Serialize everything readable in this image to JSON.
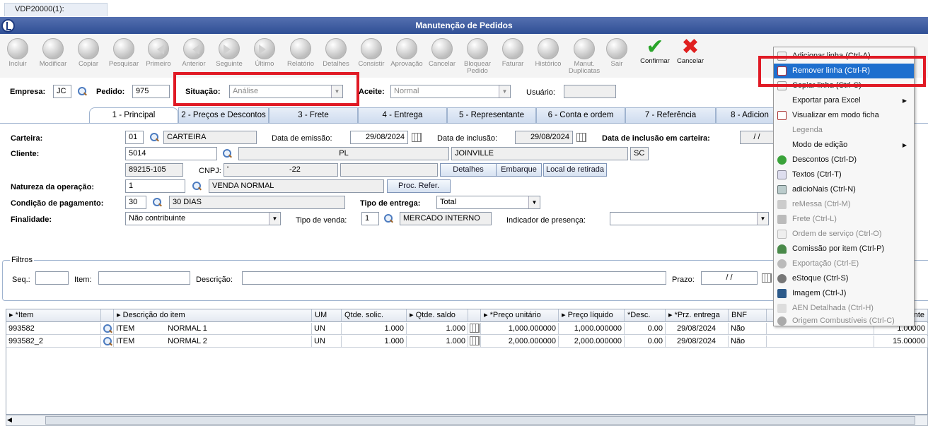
{
  "doc_tab": "VDP20000(1):",
  "window_title": "Manutenção de Pedidos",
  "toolbar": [
    {
      "id": "incluir",
      "label": "Incluir",
      "icon": "add-doc-icon"
    },
    {
      "id": "modificar",
      "label": "Modificar",
      "icon": "edit-icon"
    },
    {
      "id": "copiar",
      "label": "Copiar",
      "icon": "copy-icon"
    },
    {
      "id": "pesquisar",
      "label": "Pesquisar",
      "icon": "search-icon"
    },
    {
      "id": "primeiro",
      "label": "Primeiro",
      "icon": "first-icon"
    },
    {
      "id": "anterior",
      "label": "Anterior",
      "icon": "previous-icon"
    },
    {
      "id": "seguinte",
      "label": "Seguinte",
      "icon": "next-icon"
    },
    {
      "id": "ultimo",
      "label": "Último",
      "icon": "last-icon"
    },
    {
      "id": "relatorio",
      "label": "Relatório",
      "icon": "printer-icon"
    },
    {
      "id": "detalhes",
      "label": "Detalhes",
      "icon": "details-icon"
    },
    {
      "id": "consistir",
      "label": "Consistir",
      "icon": "consistir-icon"
    },
    {
      "id": "aprovacao",
      "label": "Aprovação",
      "icon": "approval-icon"
    },
    {
      "id": "cancelar1",
      "label": "Cancelar",
      "icon": "cancel-icon"
    },
    {
      "id": "bloquear",
      "label": "Bloquear\nPedido",
      "icon": "block-icon"
    },
    {
      "id": "faturar",
      "label": "Faturar",
      "icon": "invoice-icon"
    },
    {
      "id": "historico",
      "label": "Histórico",
      "icon": "history-icon"
    },
    {
      "id": "manut",
      "label": "Manut.\nDuplicatas",
      "icon": "duplicates-icon"
    },
    {
      "id": "sair",
      "label": "Sair",
      "icon": "exit-icon"
    },
    {
      "id": "confirmar",
      "label": "Confirmar",
      "icon": "check-icon"
    },
    {
      "id": "cancelar2",
      "label": "Cancelar",
      "icon": "x-icon"
    }
  ],
  "header": {
    "empresa_label": "Empresa:",
    "empresa": "JC",
    "pedido_label": "Pedido:",
    "pedido": "975",
    "situacao_label": "Situação:",
    "situacao": "Análise",
    "aceite_label": "Aceite:",
    "aceite": "Normal",
    "usuario_label": "Usuário:",
    "usuario": ""
  },
  "tabs": [
    {
      "label": "1 - Principal"
    },
    {
      "label": "2 - Preços e Descontos"
    },
    {
      "label": "3 - Frete"
    },
    {
      "label": "4 - Entrega"
    },
    {
      "label": "5 - Representante"
    },
    {
      "label": "6 - Conta e ordem"
    },
    {
      "label": "7 - Referência"
    },
    {
      "label": "8 - Adicion"
    }
  ],
  "form": {
    "carteira_label": "Carteira:",
    "carteira_code": "01",
    "carteira_desc": "CARTEIRA",
    "emissao_label": "Data de emissão:",
    "emissao": "29/08/2024",
    "inclusao_label": "Data de inclusão:",
    "inclusao": "29/08/2024",
    "inclusao_carteira_label": "Data de inclusão em carteira:",
    "inclusao_carteira": "/ /",
    "cliente_label": "Cliente:",
    "cliente_code": "5014",
    "cliente_name": "PL",
    "cidade": "JOINVILLE",
    "uf": "SC",
    "cep": "89215-105",
    "cnpj_label": "CNPJ:",
    "cnpj_prefix": "'",
    "cnpj": "-22",
    "btn_detalhes": "Detalhes",
    "btn_embarque": "Embarque",
    "btn_local": "Local de retirada",
    "natureza_label": "Natureza da operação:",
    "natureza_code": "1",
    "natureza_desc": "VENDA NORMAL",
    "btn_proc": "Proc. Refer.",
    "cond_label": "Condição de pagamento:",
    "cond_code": "30",
    "cond_desc": "30 DIAS",
    "tipo_entrega_label": "Tipo de entrega:",
    "tipo_entrega": "Total",
    "finalidade_label": "Finalidade:",
    "finalidade": "Não contribuinte",
    "tipo_venda_label": "Tipo de venda:",
    "tipo_venda_code": "1",
    "tipo_venda_desc": "MERCADO INTERNO",
    "presenca_label": "Indicador de presença:",
    "presenca": ""
  },
  "filters": {
    "legend": "Filtros",
    "seq_label": "Seq.:",
    "item_label": "Item:",
    "descricao_label": "Descrição:",
    "prazo_label": "Prazo:",
    "prazo": "/ /"
  },
  "grid": {
    "columns": [
      "*Item",
      "Descrição do item",
      "UM",
      "Qtde. solic.",
      "Qtde. saldo",
      "*Preço unitário",
      "Preço líquido",
      "*Desc.",
      "*Prz. entrega",
      "BNF",
      "",
      "nte"
    ],
    "rows": [
      {
        "item": "993582",
        "desc_a": "ITEM",
        "desc_b": "NORMAL 1",
        "um": "UN",
        "solic": "1.000",
        "saldo": "1.000",
        "preco": "1,000.000000",
        "liquido": "1,000.000000",
        "desc": "0.00",
        "prz": "29/08/2024",
        "bnf": "Não",
        "extra": "1.00000"
      },
      {
        "item": "993582_2",
        "desc_a": "ITEM",
        "desc_b": "NORMAL 2",
        "um": "UN",
        "solic": "1.000",
        "saldo": "1.000",
        "preco": "2,000.000000",
        "liquido": "2,000.000000",
        "desc": "0.00",
        "prz": "29/08/2024",
        "bnf": "Não",
        "extra": "15.00000"
      }
    ]
  },
  "context_menu": [
    {
      "label": "Adicionar linha (Ctrl-A)",
      "state": "normal",
      "icon": "add-row-icon"
    },
    {
      "label": "Remover linha (Ctrl-R)",
      "state": "highlighted",
      "icon": "remove-row-icon"
    },
    {
      "label": "Copiar linha (Ctrl-C)",
      "state": "normal",
      "icon": "copy-row-icon"
    },
    {
      "label": "Exportar para Excel",
      "state": "normal",
      "icon": "",
      "submenu": true
    },
    {
      "label": "Visualizar em modo ficha",
      "state": "normal",
      "icon": "form-view-icon"
    },
    {
      "label": "Legenda",
      "state": "disabled",
      "icon": ""
    },
    {
      "label": "Modo de edição",
      "state": "normal",
      "icon": "",
      "submenu": true
    },
    {
      "label": "Descontos (Ctrl-D)",
      "state": "normal",
      "icon": "discount-icon"
    },
    {
      "label": "Textos (Ctrl-T)",
      "state": "normal",
      "icon": "text-icon"
    },
    {
      "label": "adicioNais (Ctrl-N)",
      "state": "normal",
      "icon": "additional-icon"
    },
    {
      "label": "reMessa (Ctrl-M)",
      "state": "disabled",
      "icon": "remessa-icon"
    },
    {
      "label": "Frete (Ctrl-L)",
      "state": "disabled",
      "icon": "truck-icon"
    },
    {
      "label": "Ordem de serviço (Ctrl-O)",
      "state": "disabled",
      "icon": "service-order-icon"
    },
    {
      "label": "Comissão por item (Ctrl-P)",
      "state": "normal",
      "icon": "commission-icon"
    },
    {
      "label": "Exportação (Ctrl-E)",
      "state": "disabled",
      "icon": "export-icon"
    },
    {
      "label": "eStoque (Ctrl-S)",
      "state": "normal",
      "icon": "stock-icon"
    },
    {
      "label": "Imagem (Ctrl-J)",
      "state": "normal",
      "icon": "image-icon"
    },
    {
      "label": "AEN Detalhada (Ctrl-H)",
      "state": "disabled",
      "icon": "aen-icon"
    },
    {
      "label": "Origem Combustíveis (Ctrl-C)",
      "state": "disabled",
      "icon": "fuel-icon"
    }
  ]
}
